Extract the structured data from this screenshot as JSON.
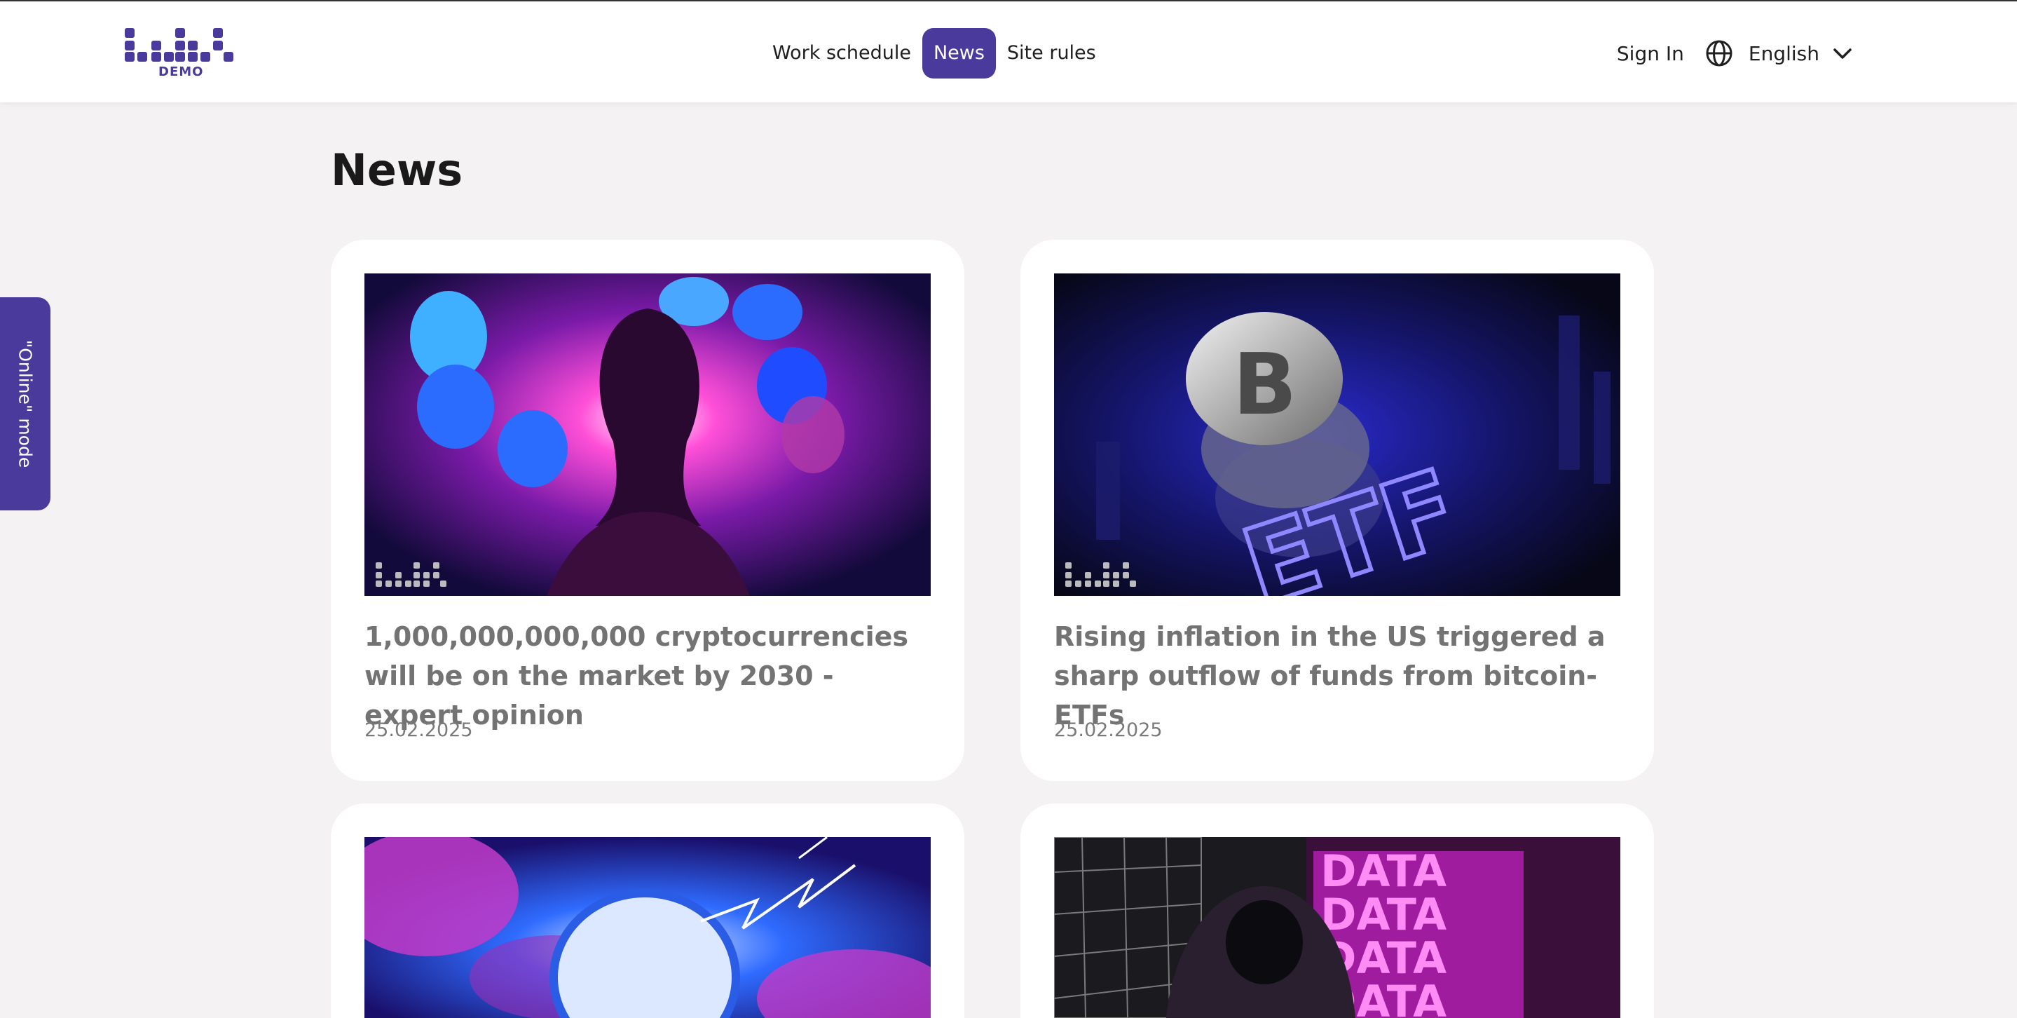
{
  "header": {
    "logo_subtitle": "DEMO",
    "nav": [
      "Work schedule",
      "News",
      "Site rules"
    ],
    "active_nav": "News",
    "sign_in": "Sign In",
    "language": "English",
    "icons": {
      "globe": "globe-icon",
      "chevron": "chevron-down-icon"
    }
  },
  "page": {
    "title": "News"
  },
  "side_tab": {
    "label": "\"Online\" mode"
  },
  "news": [
    {
      "headline": "1,000,000,000,000 cryptocurrencies will be on the market by 2030 - expert opinion",
      "date": "25.02.2025"
    },
    {
      "headline": "Rising inflation in the US triggered a sharp outflow of funds from bitcoin-ETFs",
      "date": "25.02.2025"
    },
    {
      "headline": "",
      "date": ""
    },
    {
      "headline": "",
      "date": ""
    }
  ],
  "colors": {
    "accent": "#4a3a9c",
    "background": "#f4f2f3",
    "card": "#ffffff"
  }
}
